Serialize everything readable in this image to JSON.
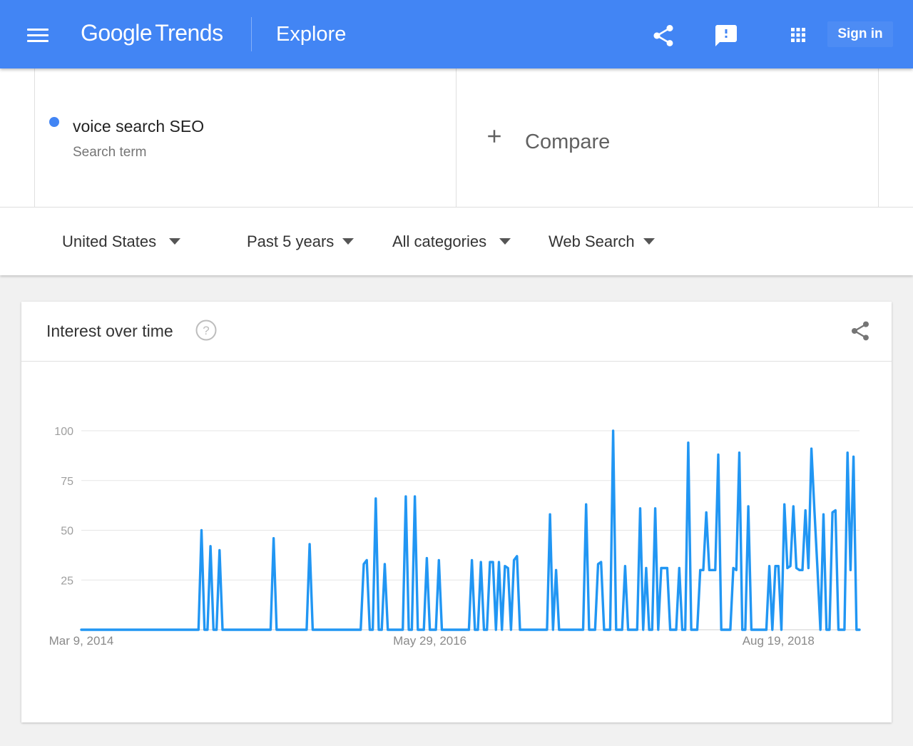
{
  "header": {
    "logo_google": "Google",
    "logo_trends": "Trends",
    "page_title": "Explore",
    "sign_in_label": "Sign in",
    "icons": [
      "menu-icon",
      "share-icon",
      "feedback-icon",
      "apps-grid-icon"
    ]
  },
  "search": {
    "term": "voice search SEO",
    "term_type": "Search term",
    "term_color": "#4285f4",
    "compare_label": "Compare"
  },
  "filters": {
    "region": "United States",
    "time_range": "Past 5 years",
    "category": "All categories",
    "search_type": "Web Search"
  },
  "interest_card": {
    "title": "Interest over time"
  },
  "colors": {
    "topbar": "#4285f4",
    "series": "#2196f3"
  },
  "chart_data": {
    "type": "line",
    "title": "",
    "xlabel": "",
    "ylabel": "",
    "ylim": [
      0,
      100
    ],
    "yticks": [
      25,
      50,
      75,
      100
    ],
    "grid": true,
    "x_start": "Mar 9, 2014",
    "x_end": "Mar 3, 2019",
    "x_tick_labels": [
      {
        "label": "Mar 9, 2014",
        "index": 0
      },
      {
        "label": "May 29, 2016",
        "index": 116
      },
      {
        "label": "Aug 19, 2018",
        "index": 232
      }
    ],
    "series": [
      {
        "values": [
          0,
          0,
          0,
          0,
          0,
          0,
          0,
          0,
          0,
          0,
          0,
          0,
          0,
          0,
          0,
          0,
          0,
          0,
          0,
          0,
          0,
          0,
          0,
          0,
          0,
          0,
          0,
          0,
          0,
          0,
          0,
          0,
          0,
          0,
          0,
          0,
          0,
          0,
          0,
          0,
          50,
          0,
          0,
          42,
          0,
          0,
          40,
          0,
          0,
          0,
          0,
          0,
          0,
          0,
          0,
          0,
          0,
          0,
          0,
          0,
          0,
          0,
          0,
          0,
          46,
          0,
          0,
          0,
          0,
          0,
          0,
          0,
          0,
          0,
          0,
          0,
          43,
          0,
          0,
          0,
          0,
          0,
          0,
          0,
          0,
          0,
          0,
          0,
          0,
          0,
          0,
          0,
          0,
          0,
          33,
          35,
          0,
          0,
          66,
          0,
          0,
          33,
          0,
          0,
          0,
          0,
          0,
          0,
          67,
          0,
          0,
          67,
          0,
          0,
          0,
          36,
          0,
          0,
          0,
          35,
          0,
          0,
          0,
          0,
          0,
          0,
          0,
          0,
          0,
          0,
          35,
          0,
          0,
          34,
          0,
          0,
          34,
          34,
          0,
          34,
          0,
          32,
          31,
          0,
          35,
          37,
          0,
          0,
          0,
          0,
          0,
          0,
          0,
          0,
          0,
          0,
          58,
          0,
          30,
          0,
          0,
          0,
          0,
          0,
          0,
          0,
          0,
          0,
          63,
          0,
          0,
          0,
          33,
          34,
          0,
          0,
          0,
          100,
          0,
          0,
          0,
          32,
          0,
          0,
          0,
          0,
          61,
          0,
          31,
          0,
          0,
          61,
          0,
          31,
          31,
          31,
          0,
          0,
          0,
          31,
          0,
          0,
          94,
          0,
          0,
          0,
          30,
          30,
          59,
          30,
          30,
          30,
          88,
          0,
          0,
          0,
          0,
          31,
          30,
          89,
          0,
          0,
          62,
          0,
          0,
          0,
          0,
          0,
          0,
          32,
          0,
          32,
          32,
          0,
          63,
          31,
          32,
          62,
          31,
          30,
          30,
          60,
          31,
          91,
          60,
          31,
          0,
          58,
          0,
          0,
          59,
          60,
          0,
          0,
          0,
          89,
          30,
          87,
          0,
          0
        ]
      }
    ]
  }
}
